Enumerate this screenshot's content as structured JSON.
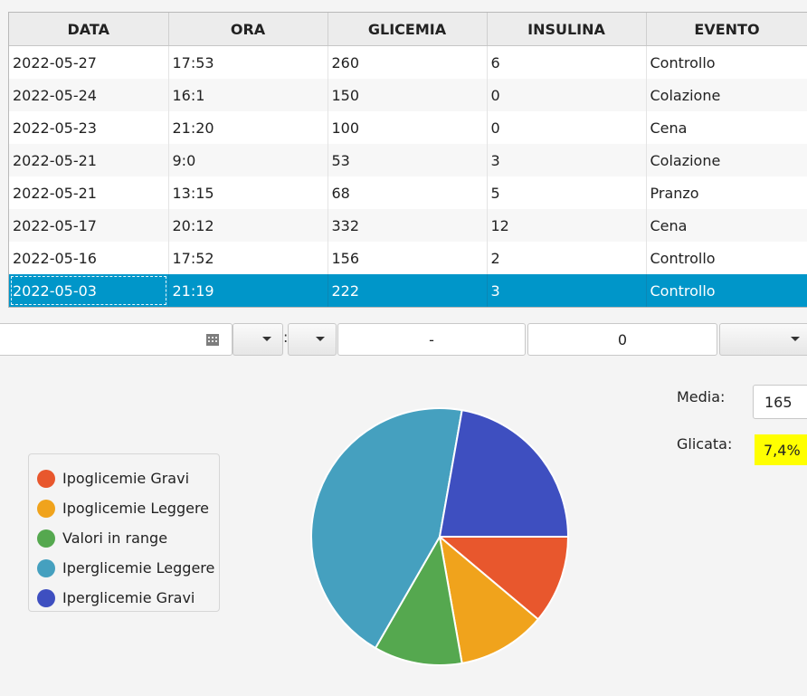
{
  "table": {
    "columns": [
      "DATA",
      "ORA",
      "GLICEMIA",
      "INSULINA",
      "EVENTO"
    ],
    "rows": [
      [
        "2022-05-27",
        "17:53",
        "260",
        "6",
        "Controllo"
      ],
      [
        "2022-05-24",
        "16:1",
        "150",
        "0",
        "Colazione"
      ],
      [
        "2022-05-23",
        "21:20",
        "100",
        "0",
        "Cena"
      ],
      [
        "2022-05-21",
        "9:0",
        "53",
        "3",
        "Colazione"
      ],
      [
        "2022-05-21",
        "13:15",
        "68",
        "5",
        "Pranzo"
      ],
      [
        "2022-05-17",
        "20:12",
        "332",
        "12",
        "Cena"
      ],
      [
        "2022-05-16",
        "17:52",
        "156",
        "2",
        "Controllo"
      ],
      [
        "2022-05-03",
        "21:19",
        "222",
        "3",
        "Controllo"
      ]
    ],
    "selected_row": 7
  },
  "form": {
    "colon": ":",
    "dash_field": "-",
    "number_field": "0"
  },
  "stats": {
    "media_label": "Media:",
    "media_value": "165",
    "glicata_label": "Glicata:",
    "glicata_value": "7,4%"
  },
  "chart_data": {
    "type": "pie",
    "title": "",
    "legend_position": "left",
    "series": [
      {
        "name": "Ipoglicemie Gravi",
        "value": 1,
        "color": "#e8572d"
      },
      {
        "name": "Ipoglicemie Leggere",
        "value": 1,
        "color": "#f0a31c"
      },
      {
        "name": "Valori in range",
        "value": 1,
        "color": "#55a84f"
      },
      {
        "name": "Iperglicemie Leggere",
        "value": 4,
        "color": "#45a0bf"
      },
      {
        "name": "Iperglicemie Gravi",
        "value": 2,
        "color": "#3e4fc0"
      }
    ]
  }
}
